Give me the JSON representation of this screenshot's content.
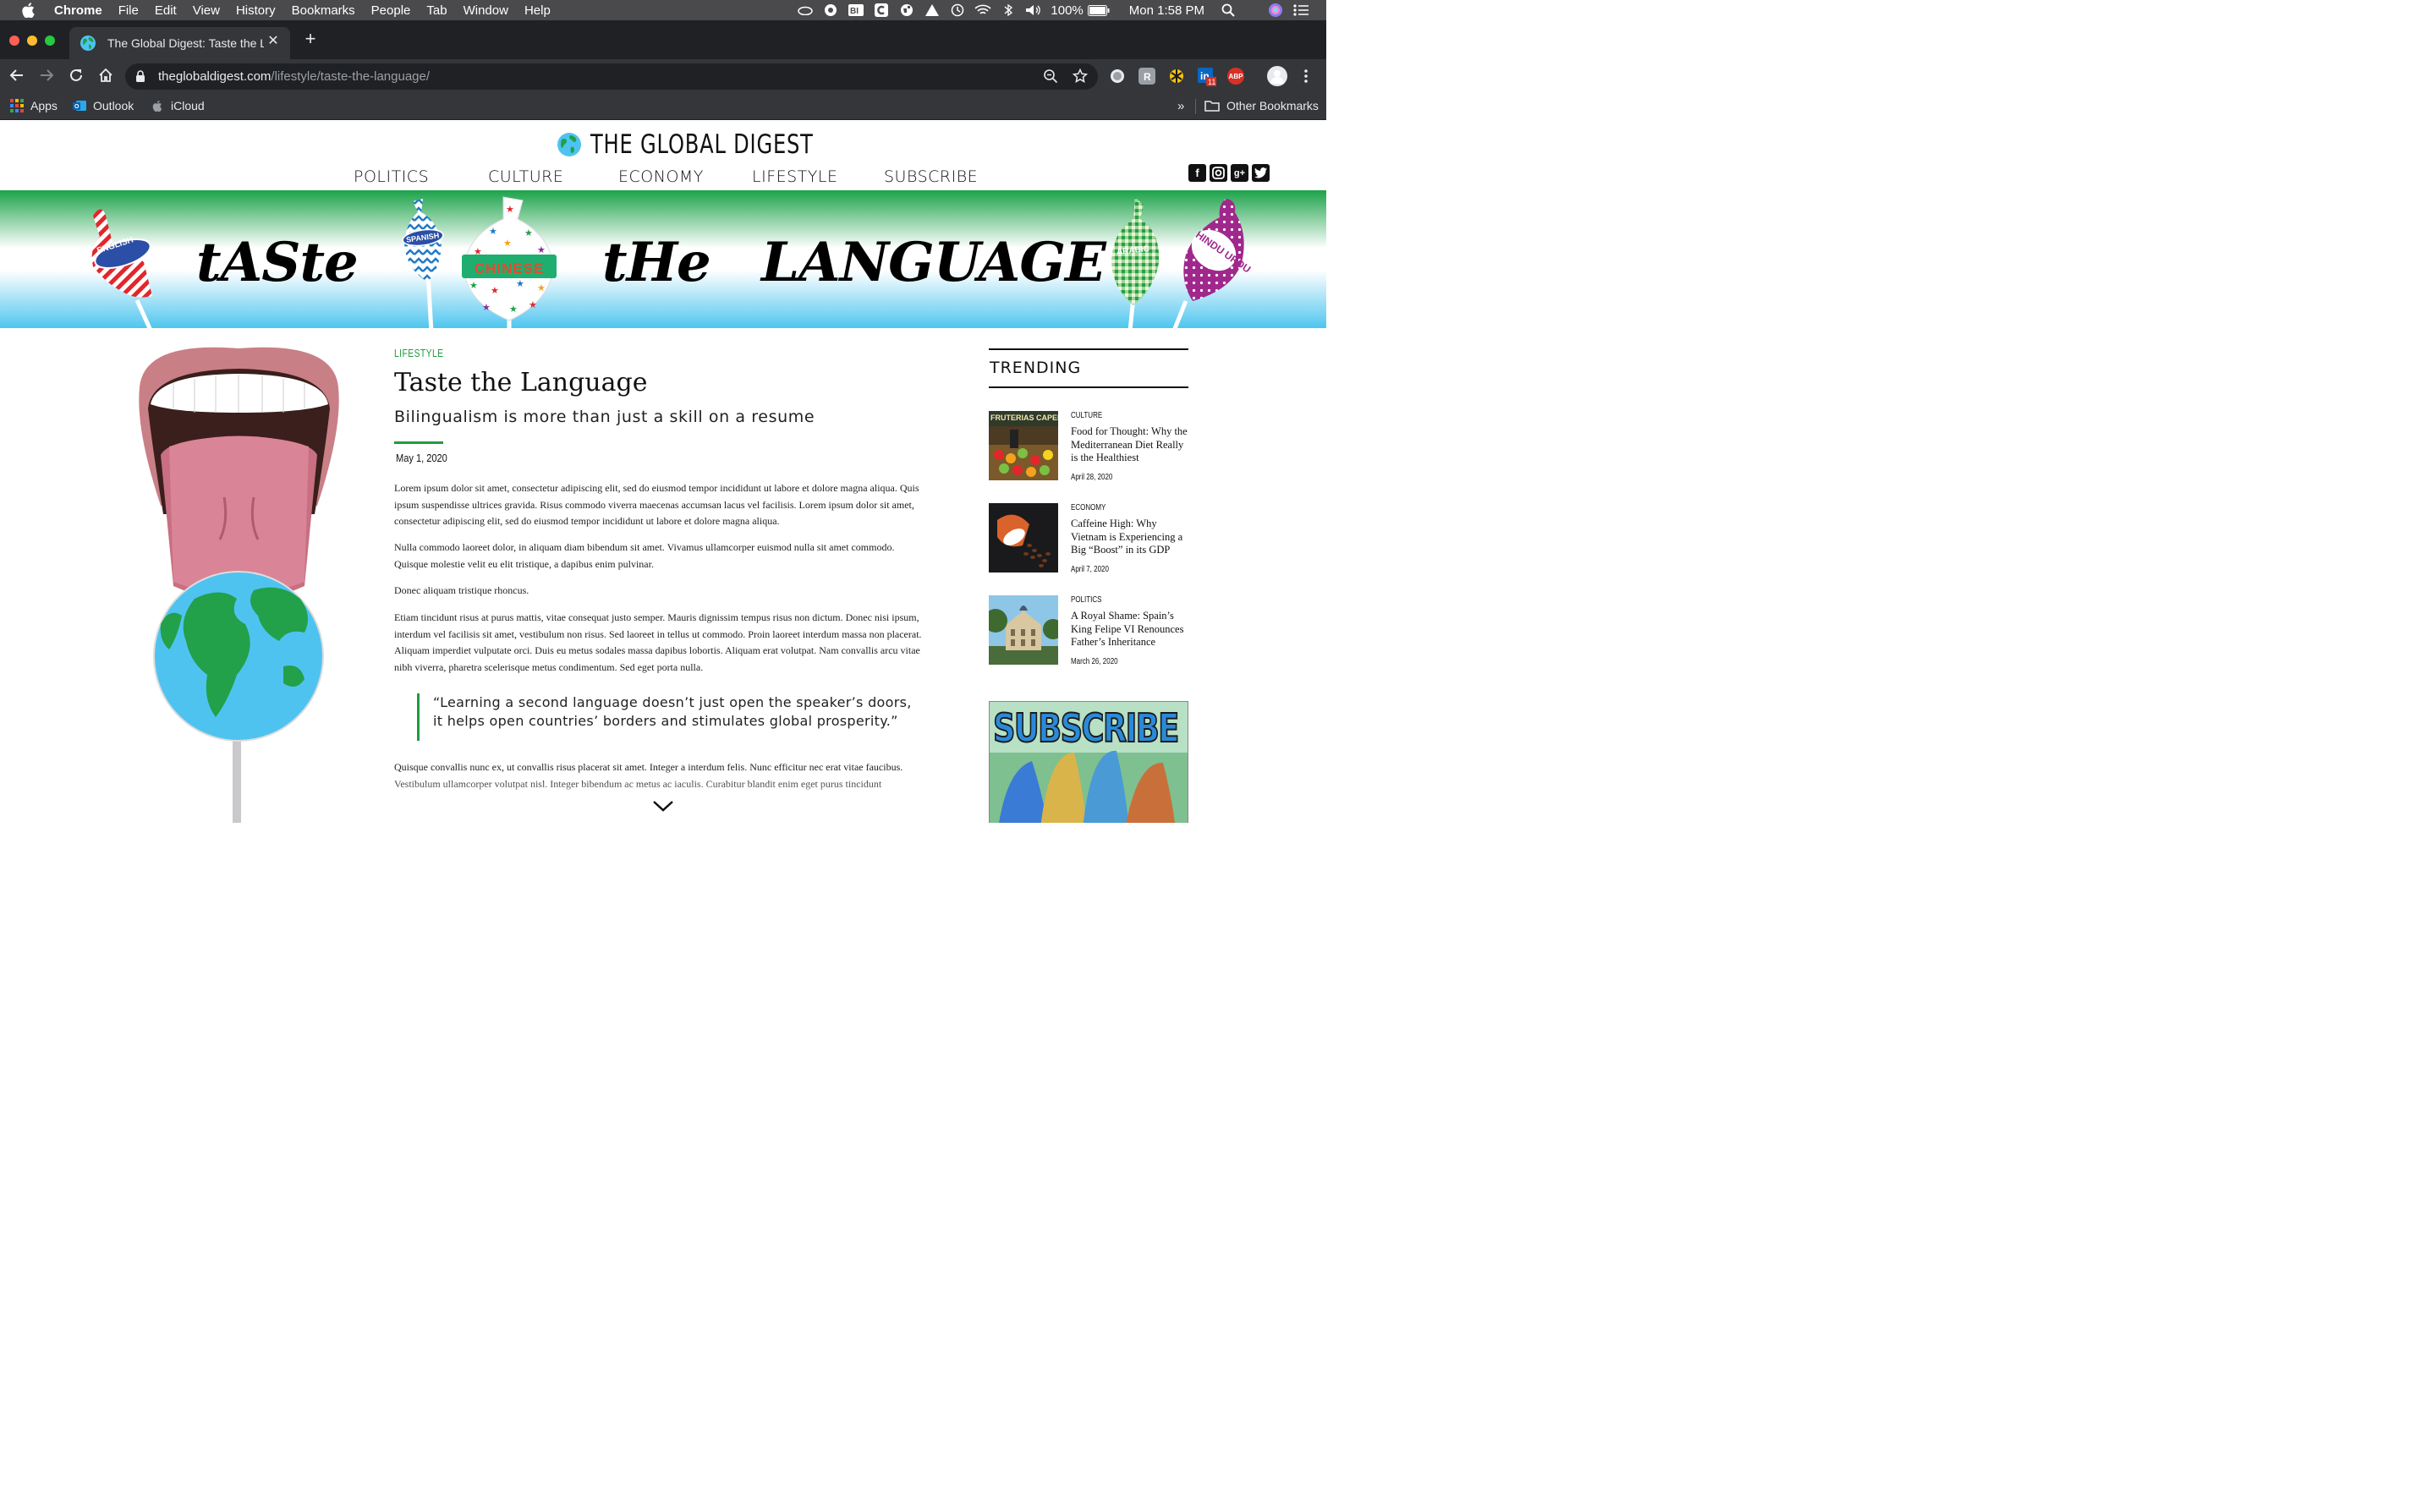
{
  "menubar": {
    "app_name": "Chrome",
    "items": [
      "File",
      "Edit",
      "View",
      "History",
      "Bookmarks",
      "People",
      "Tab",
      "Window",
      "Help"
    ],
    "battery": "100%",
    "clock": "Mon 1:58 PM"
  },
  "browser": {
    "tab_title": "The Global Digest: Taste the L",
    "url_host": "theglobaldigest.com",
    "url_path": "/lifestyle/taste-the-language/",
    "linkedin_badge": "11",
    "abp_label": "ABP",
    "bookmarks": [
      "Apps",
      "Outlook",
      "iCloud"
    ],
    "overflow": "»",
    "other_bookmarks": "Other Bookmarks"
  },
  "site": {
    "name": "THE GLOBAL DIGEST",
    "nav": [
      "POLITICS",
      "CULTURE",
      "ECONOMY",
      "LIFESTYLE",
      "SUBSCRIBE"
    ],
    "social": [
      "f",
      "◘",
      "g+",
      "t"
    ]
  },
  "hero": {
    "words": [
      "tASte",
      "tHe",
      "LANGUAGE"
    ],
    "lollipops": [
      "ENGLISH",
      "SPANISH",
      "CHINESE",
      "ARABIC",
      "HINDU URDU"
    ]
  },
  "article": {
    "category": "LIFESTYLE",
    "title": "Taste the Language",
    "subtitle": "Bilingualism is more than just a skill on a resume",
    "date": "May 1, 2020",
    "paragraphs": [
      "Lorem ipsum dolor sit amet, consectetur adipiscing elit, sed do eiusmod tempor incididunt ut labore et dolore magna aliqua. Quis ipsum suspendisse ultrices gravida. Risus commodo viverra maecenas accumsan lacus vel facilisis. Lorem ipsum dolor sit amet, consectetur adipiscing elit, sed do eiusmod tempor incididunt ut labore et dolore magna aliqua.",
      "Nulla commodo laoreet dolor, in aliquam diam bibendum sit amet. Vivamus ullamcorper euismod nulla sit amet commodo. Quisque molestie velit eu elit tristique, a dapibus enim pulvinar.",
      "Donec aliquam tristique rhoncus.",
      "Etiam tincidunt risus at purus mattis, vitae consequat justo semper. Mauris dignissim tempus risus non dictum. Donec nisi ipsum, interdum vel facilisis sit amet, vestibulum non risus. Sed laoreet in tellus ut commodo. Proin laoreet interdum massa non placerat. Aliquam imperdiet vulputate orci. Duis eu metus sodales massa dapibus lobortis. Aliquam erat volutpat. Nam convallis arcu vitae nibh viverra, pharetra scelerisque metus condimentum. Sed eget porta nulla."
    ],
    "quote": "“Learning a second language doesn’t just open the speaker’s doors, it helps open countries’ borders and stimulates global prosperity.”",
    "after_quote": "Quisque convallis nunc ex, ut convallis risus placerat sit amet. Integer a interdum felis. Nunc efficitur nec erat vitae faucibus. Vestibulum ullamcorper volutpat nisl. Integer bibendum ac metus ac iaculis. Curabitur blandit enim eget purus tincidunt"
  },
  "trending": {
    "heading": "TRENDING",
    "items": [
      {
        "category": "CULTURE",
        "title": "Food for Thought: Why the Mediterranean Diet Really is the Healthiest",
        "date": "April 28, 2020",
        "thumb_text": "FRUTERIAS CAPELL"
      },
      {
        "category": "ECONOMY",
        "title": "Caffeine High: Why Vietnam is Experiencing a Big “Boost” in its GDP",
        "date": "April 7, 2020"
      },
      {
        "category": "POLITICS",
        "title": "A Royal Shame: Spain’s King Felipe VI Renounces Father’s Inheritance",
        "date": "March 26, 2020"
      }
    ],
    "subscribe_ad": "SUBSCRIBE"
  },
  "colors": {
    "accent_green": "#1e9d3f",
    "hero_top": "#1ca24a",
    "hero_bottom": "#4fc6ef"
  }
}
